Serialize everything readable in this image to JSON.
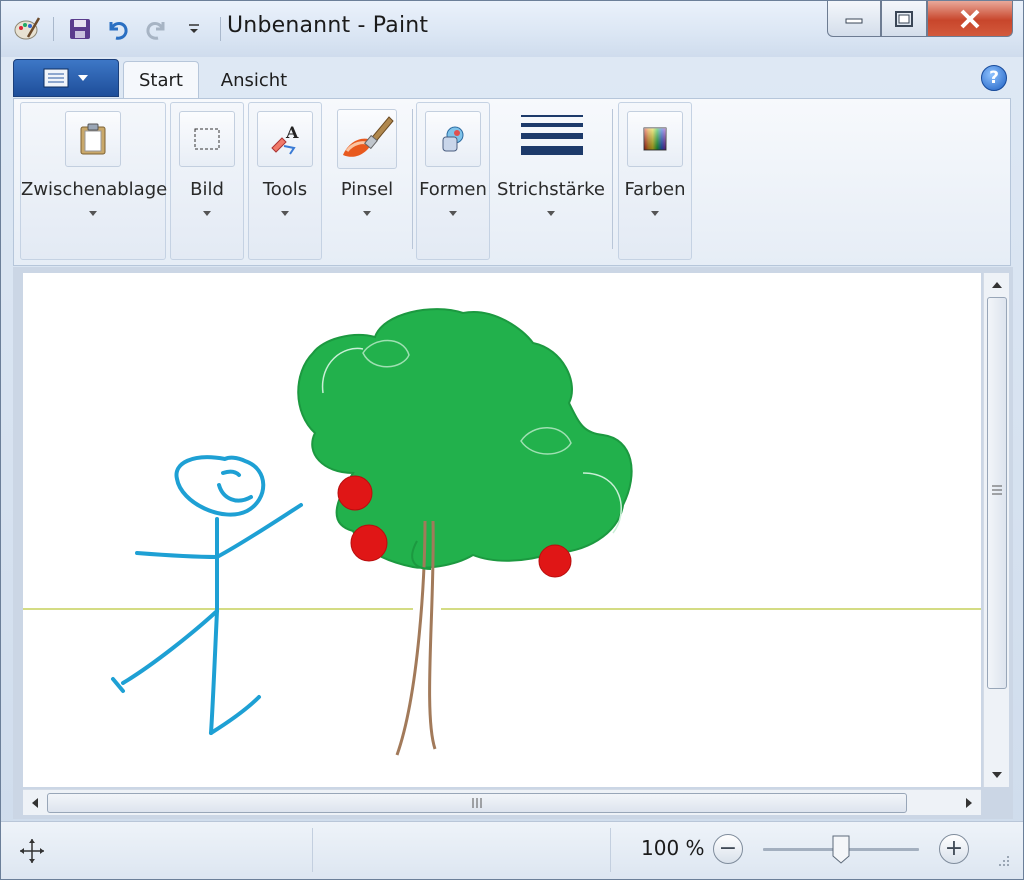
{
  "window": {
    "title": "Unbenannt - Paint",
    "quick_access": [
      "paint-app-icon",
      "save-icon",
      "undo-icon",
      "redo-icon",
      "customize-dropdown-icon"
    ]
  },
  "tabs": [
    {
      "label": "Start",
      "active": true
    },
    {
      "label": "Ansicht",
      "active": false
    }
  ],
  "ribbon": {
    "groups": [
      {
        "label": "Zwischenablage",
        "icon": "clipboard-icon"
      },
      {
        "label": "Bild",
        "icon": "select-icon"
      },
      {
        "label": "Tools",
        "icon": "tools-icon"
      },
      {
        "label": "Pinsel",
        "icon": "brush-icon"
      },
      {
        "label": "Formen",
        "icon": "shapes-icon"
      },
      {
        "label": "Strichstärke",
        "icon": "line-width-icon"
      },
      {
        "label": "Farben",
        "icon": "colors-icon"
      }
    ]
  },
  "canvas": {
    "drawing": "stick-figure-and-apple-tree",
    "colors": {
      "figure": "#1ea0d4",
      "foliage": "#22b14c",
      "trunk": "#a27a5a",
      "apples": "#e01616",
      "horizon": "#d4dc84"
    }
  },
  "status": {
    "zoom": "100 %",
    "zoom_level": 1.0
  }
}
